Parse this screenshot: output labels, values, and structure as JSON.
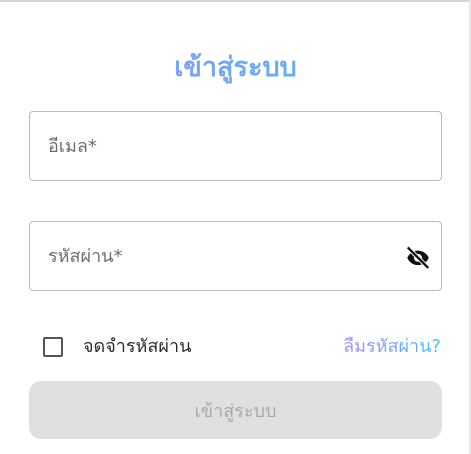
{
  "login": {
    "title": "เข้าสู่ระบบ",
    "email": {
      "placeholder": "อีเมล*",
      "value": ""
    },
    "password": {
      "placeholder": "รหัสผ่าน*",
      "value": "",
      "toggle_icon": "eye-off-icon"
    },
    "remember_label": "จดจำรหัสผ่าน",
    "remember_checked": false,
    "forgot_label": "ลืมรหัสผ่าน?",
    "submit_label": "เข้าสู่ระบบ",
    "submit_disabled": true
  },
  "colors": {
    "gradient_start": "#a98ef3",
    "gradient_mid": "#6fa8f5",
    "gradient_end": "#4cc2f0",
    "field_border": "#b9bcc1",
    "button_disabled_bg": "#e0e0e0",
    "button_disabled_text": "#a8a8a8"
  }
}
